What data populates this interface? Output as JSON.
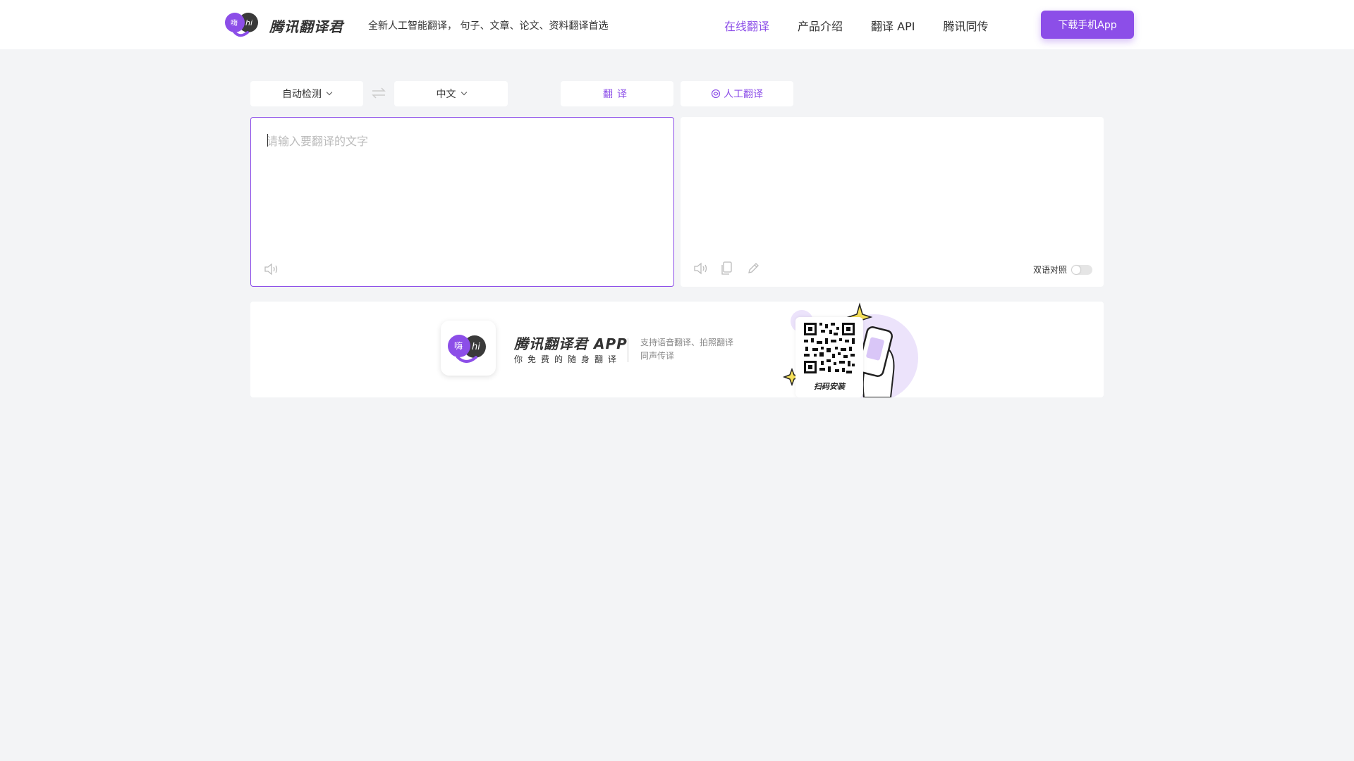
{
  "header": {
    "logo_text": "腾讯翻译君",
    "logo_badge_left": "嗨",
    "logo_badge_right": "hi",
    "slogan": "全新人工智能翻译， 句子、文章、论文、资料翻译首选",
    "nav": [
      {
        "label": "在线翻译",
        "active": true
      },
      {
        "label": "产品介绍",
        "active": false
      },
      {
        "label": "翻译 API",
        "active": false
      },
      {
        "label": "腾讯同传",
        "active": false
      }
    ],
    "download_label": "下载手机App"
  },
  "controls": {
    "source_lang": "自动检测",
    "target_lang": "中文",
    "translate_label": "翻译",
    "human_label": "人工翻译"
  },
  "source_panel": {
    "placeholder": "请输入要翻译的文字",
    "value": ""
  },
  "target_panel": {
    "bilingual_label": "双语对照",
    "bilingual_on": false
  },
  "banner": {
    "app_title": "腾讯翻译君 APP",
    "app_subtitle": "你免费的随身翻译",
    "feature_line1": "支持语音翻译、拍照翻译",
    "feature_line2": "同声传译",
    "qr_label": "扫码安装"
  },
  "colors": {
    "accent": "#8c4ee8",
    "background": "#f3f4f6",
    "logo_dark": "#3a3a3a",
    "star": "#f5e05a",
    "art_bg": "#ece3fb"
  }
}
